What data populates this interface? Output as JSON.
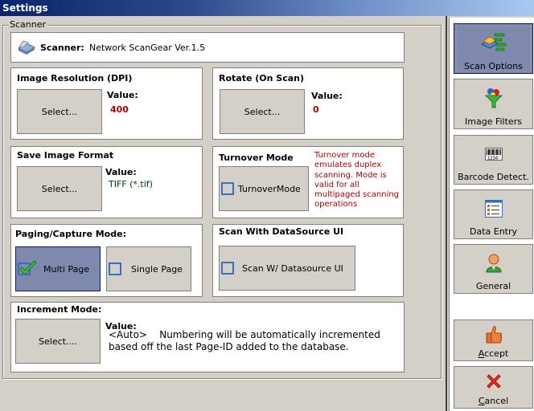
{
  "window": {
    "title": "Settings"
  },
  "scanner_group": {
    "legend": "Scanner",
    "scanner": {
      "label": "Scanner:",
      "name": "Network ScanGear Ver.1.5",
      "icon": "scanner-icon"
    }
  },
  "panels": {
    "resolution": {
      "title": "Image Resolution (DPI)",
      "button": "Select...",
      "value_label": "Value:",
      "value": "400"
    },
    "rotate": {
      "title": "Rotate (On Scan)",
      "button": "Select...",
      "value_label": "Value:",
      "value": "0"
    },
    "format": {
      "title": "Save Image Format",
      "button": "Select...",
      "value_label": "Value:",
      "value": "TIFF (*.tif)"
    },
    "turnover": {
      "title": "Turnover Mode",
      "checkbox_label": "TurnoverMode",
      "checked": false,
      "note": "Turnover mode emulates duplex scanning.  Mode is valid for all multipaged scanning operations"
    },
    "paging": {
      "title": "Paging/Capture Mode:",
      "options": [
        {
          "label": "Multi Page",
          "checked": true
        },
        {
          "label": "Single Page",
          "checked": false
        }
      ]
    },
    "datasource": {
      "title": "Scan With DataSource UI",
      "checkbox_label": "Scan W/ Datasource UI",
      "checked": false
    },
    "increment": {
      "title": "Increment Mode:",
      "button": "Select....",
      "value_label": "Value:",
      "value_line1": "<Auto>    Numbering will be automatically incremented",
      "value_line2": "based off the last Page-ID added to the database."
    }
  },
  "sidebar": {
    "items": [
      {
        "label": "Scan Options",
        "icon": "scan-options-icon",
        "active": true
      },
      {
        "label": "Image Filters",
        "icon": "image-filter-icon",
        "active": false
      },
      {
        "label": "Barcode Detect.",
        "icon": "barcode-icon",
        "active": false
      },
      {
        "label": "Data Entry",
        "icon": "data-entry-icon",
        "active": false
      },
      {
        "label": "General",
        "icon": "user-icon",
        "active": false
      }
    ],
    "accept": {
      "label_first": "A",
      "label_rest": "ccept",
      "icon": "thumbs-up-icon"
    },
    "cancel": {
      "label_first": "C",
      "label_rest": "ancel",
      "icon": "red-x-icon"
    }
  }
}
